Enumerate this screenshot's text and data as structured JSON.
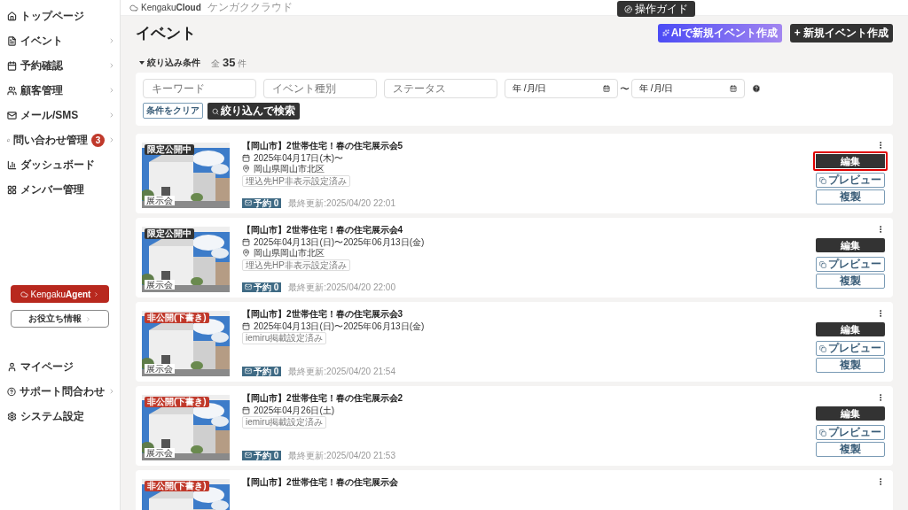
{
  "sidebar": {
    "items": [
      {
        "label": "トップページ",
        "has_children": false
      },
      {
        "label": "イベント",
        "has_children": true
      },
      {
        "label": "予約確認",
        "has_children": true
      },
      {
        "label": "顧客管理",
        "has_children": true
      },
      {
        "label": "メール/SMS",
        "has_children": true
      },
      {
        "label": "問い合わせ管理",
        "has_children": true,
        "badge": "3"
      },
      {
        "label": "ダッシュボード",
        "has_children": false
      },
      {
        "label": "メンバー管理",
        "has_children": false
      }
    ],
    "agent_button": {
      "brand_light": "Kengaku",
      "brand_bold": "Agent"
    },
    "info_button": "お役立ち情報",
    "bottom_items": [
      {
        "label": "マイページ",
        "has_children": false
      },
      {
        "label": "サポート問合わせ",
        "has_children": true
      },
      {
        "label": "システム設定",
        "has_children": false
      }
    ]
  },
  "header": {
    "logo_light": "Kengaku",
    "logo_bold": "Cloud",
    "logo_sub": "ケンガククラウド",
    "guide_button": "操作ガイド"
  },
  "page": {
    "title": "イベント",
    "ai_button": "AIで新規イベント作成",
    "new_button": "+ 新規イベント作成"
  },
  "filter": {
    "toggle": "絞り込み条件",
    "expanded": true,
    "total_prefix": "全",
    "total": "35",
    "total_suffix": "件",
    "fields": [
      {
        "kind": "text",
        "placeholder": "キーワード"
      },
      {
        "kind": "text",
        "placeholder": "イベント種別"
      },
      {
        "kind": "text",
        "placeholder": "ステータス"
      },
      {
        "kind": "date",
        "value": "年 /月/日"
      },
      {
        "kind": "date",
        "value": "年 /月/日"
      }
    ],
    "range_separator": "〜",
    "clear_button": "条件をクリア",
    "search_button": "絞り込んで検索"
  },
  "events": [
    {
      "title": "【岡山市】2世帯住宅！春の住宅展示会5",
      "status": {
        "label": "限定公開中",
        "kind": "limited"
      },
      "category": "展示会",
      "date": "2025年04月17日(木)〜",
      "location": "岡山県岡山市北区",
      "tag": "埋込先HP非表示設定済み",
      "reservations": "予約 0",
      "updated": "最終更新:2025/04/20 22:01",
      "edit": "編集",
      "preview": "プレビュー",
      "copy": "複製",
      "highlighted": true
    },
    {
      "title": "【岡山市】2世帯住宅！春の住宅展示会4",
      "status": {
        "label": "限定公開中",
        "kind": "limited"
      },
      "category": "展示会",
      "date": "2025年04月13日(日)〜2025年06月13日(金)",
      "location": "岡山県岡山市北区",
      "tag": "埋込先HP非表示設定済み",
      "reservations": "予約 0",
      "updated": "最終更新:2025/04/20 22:00",
      "edit": "編集",
      "preview": "プレビュー",
      "copy": "複製",
      "highlighted": false
    },
    {
      "title": "【岡山市】2世帯住宅！春の住宅展示会3",
      "status": {
        "label": "非公開(下書き)",
        "kind": "draft"
      },
      "category": "展示会",
      "date": "2025年04月13日(日)〜2025年06月13日(金)",
      "tag": "iemiru掲載設定済み",
      "reservations": "予約 0",
      "updated": "最終更新:2025/04/20 21:54",
      "edit": "編集",
      "preview": "プレビュー",
      "copy": "複製",
      "highlighted": false
    },
    {
      "title": "【岡山市】2世帯住宅！春の住宅展示会2",
      "status": {
        "label": "非公開(下書き)",
        "kind": "draft"
      },
      "category": "展示会",
      "date": "2025年04月26日(土)",
      "tag": "iemiru掲載設定済み",
      "reservations": "予約 0",
      "updated": "最終更新:2025/04/20 21:53",
      "edit": "編集",
      "preview": "プレビュー",
      "copy": "複製",
      "highlighted": false
    },
    {
      "title": "【岡山市】2世帯住宅！春の住宅展示会",
      "status": {
        "label": "非公開(下書き)",
        "kind": "draft"
      }
    }
  ]
}
